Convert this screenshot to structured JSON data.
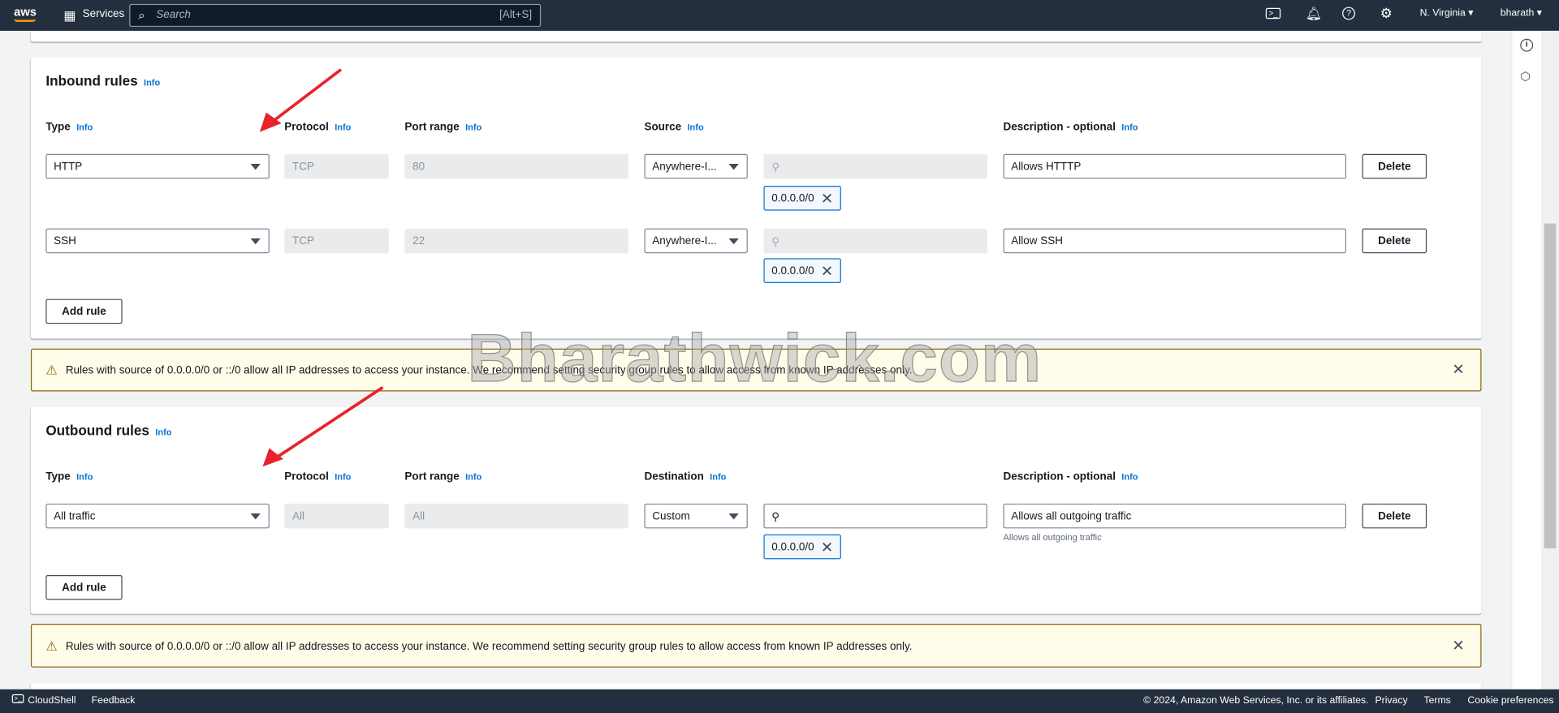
{
  "header": {
    "logo": "aws",
    "services": "Services",
    "search_placeholder": "Search",
    "search_shortcut": "[Alt+S]",
    "region": "N. Virginia ▾",
    "user": "bharath ▾",
    "icons": [
      "cloudshell-icon",
      "bell-icon",
      "help-icon",
      "gear-icon"
    ]
  },
  "inbound": {
    "title": "Inbound rules",
    "info": "Info",
    "columns": {
      "type": "Type",
      "protocol": "Protocol",
      "port": "Port range",
      "source": "Source",
      "description": "Description - optional"
    },
    "rows": [
      {
        "type": "HTTP",
        "protocol": "TCP",
        "port": "80",
        "source": "Anywhere-I...",
        "cidr": "0.0.0.0/0",
        "description": "Allows HTTTP",
        "delete": "Delete"
      },
      {
        "type": "SSH",
        "protocol": "TCP",
        "port": "22",
        "source": "Anywhere-I...",
        "cidr": "0.0.0.0/0",
        "description": "Allow SSH",
        "delete": "Delete"
      }
    ],
    "add_rule": "Add rule"
  },
  "warning": "Rules with source of 0.0.0.0/0 or ::/0 allow all IP addresses to access your instance. We recommend setting security group rules to allow access from known IP addresses only.",
  "outbound": {
    "title": "Outbound rules",
    "info": "Info",
    "columns": {
      "type": "Type",
      "protocol": "Protocol",
      "port": "Port range",
      "destination": "Destination",
      "description": "Description - optional"
    },
    "rows": [
      {
        "type": "All traffic",
        "protocol": "All",
        "port": "All",
        "destination": "Custom",
        "cidr": "0.0.0.0/0",
        "description": "Allows all outgoing traffic",
        "help": "Allows all outgoing traffic",
        "delete": "Delete"
      }
    ],
    "add_rule": "Add rule"
  },
  "watermark": "Bharathwick.com",
  "footer": {
    "cloudshell": "CloudShell",
    "feedback": "Feedback",
    "copyright": "© 2024, Amazon Web Services, Inc. or its affiliates.",
    "privacy": "Privacy",
    "terms": "Terms",
    "cookies": "Cookie preferences"
  },
  "colors": {
    "header": "#232f3e",
    "link": "#0972d3",
    "arrow": "#e8232a",
    "warning_bg": "#fffce9"
  }
}
